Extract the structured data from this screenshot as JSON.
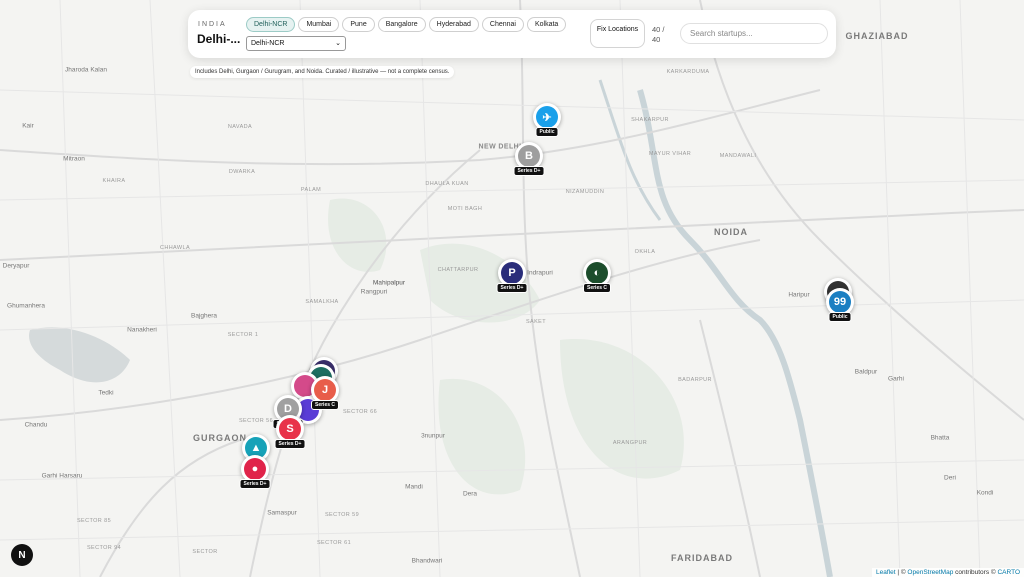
{
  "panel": {
    "country": "INDIA",
    "city_title": "Delhi-...",
    "cities": [
      "Delhi-NCR",
      "Mumbai",
      "Pune",
      "Bangalore",
      "Hyderabad",
      "Chennai",
      "Kolkata"
    ],
    "active_city": "Delhi-NCR",
    "select_value": "Delhi-NCR",
    "fix_button": "Fix Locations",
    "count": "40 / 40",
    "search_placeholder": "Search startups..."
  },
  "note": "Includes Delhi, Gurgaon / Gurugram, and Noida. Curated / illustrative — not a complete census.",
  "map_labels": {
    "places": [
      "GHAZIABAD",
      "NOIDA",
      "FARIDABAD",
      "GURGAON",
      "NEW DELHI",
      "Mahipalpur",
      "Rangpuri",
      "Jharoda Kalan",
      "Kair",
      "Mitraon",
      "KHAIRA",
      "DWARKA",
      "PALAM",
      "Deryapur",
      "Ghumanhera",
      "Nanakheri",
      "Bajghera",
      "SECTOR 1",
      "Tedki",
      "Chandu",
      "Garhi Harsaru",
      "Samaspur",
      "Mandi",
      "Dera",
      "3nunpur",
      "Bhandwari",
      "Baldpur",
      "Garhi",
      "Bhatta",
      "Kondi",
      "Deri",
      "Haripur",
      "Indrapuri",
      "MOTI BAGH",
      "KARKARDUMA",
      "SHAKARPUR",
      "MAYUR VIHAR",
      "MANDAWALI",
      "OKHLA",
      "NIZAMUDDIN",
      "SAKET",
      "BADARPUR",
      "CHHAWLA",
      "NAVADA",
      "SAMALKHA",
      "DHAULA KUAN",
      "CHATTARPUR",
      "ARANGPUR",
      "SECTOR 56",
      "SECTOR 59",
      "SECTOR 61",
      "SECTOR 66",
      "SECTOR 85",
      "SECTOR 94",
      "SECTOR",
      "Mahipalpur"
    ]
  },
  "markers": [
    {
      "name": "marker-public-1",
      "logo": "✈",
      "color": "#1aa0ea",
      "tag": "Public"
    },
    {
      "name": "marker-b",
      "logo": "B",
      "color": "#9e9e9e",
      "tag": "Series D+"
    },
    {
      "name": "marker-p",
      "logo": "P",
      "color": "#2a2d7a",
      "tag": "Series D+"
    },
    {
      "name": "marker-c",
      "logo": "◐",
      "color": "#1c4d2c",
      "tag": "Series C"
    },
    {
      "name": "marker-99",
      "logo": "99",
      "color": "#1b7fc2",
      "tag": "Public"
    },
    {
      "name": "marker-j",
      "logo": "J",
      "color": "#e85d4a",
      "tag": "Series C"
    },
    {
      "name": "marker-d",
      "logo": "D",
      "color": "#a0a0a0",
      "tag": "Series D+"
    },
    {
      "name": "marker-s",
      "logo": "S",
      "color": "#e8334a",
      "tag": "Series D+"
    },
    {
      "name": "marker-tri",
      "logo": "▲",
      "color": "#17a2b8",
      "tag": ""
    },
    {
      "name": "marker-redcircle",
      "logo": "●",
      "color": "#e0244a",
      "tag": "Series D+"
    }
  ],
  "badge": "N",
  "attribution": {
    "leaflet": "Leaflet",
    "sep1": " | © ",
    "osm": "OpenStreetMap",
    "mid": " contributors © ",
    "carto": "CARTO"
  },
  "colors": {
    "accent": "#1f5f59",
    "map_bg": "#f4f4f2",
    "river": "#c9d4d8",
    "park": "#e4ebe3"
  }
}
